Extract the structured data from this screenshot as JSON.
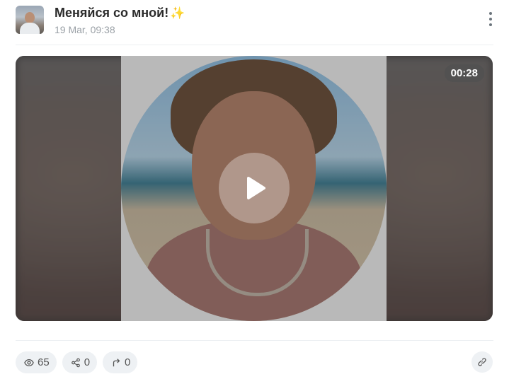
{
  "post": {
    "title": "Меняйся со мной!",
    "title_emoji": "✨",
    "date": "19 Mar, 09:38",
    "menu_icon": "more-vertical-icon"
  },
  "video": {
    "duration": "00:28",
    "play_icon": "play-icon"
  },
  "stats": {
    "views": "65",
    "shares": "0",
    "reposts": "0",
    "views_icon": "eye-icon",
    "shares_icon": "share-icon",
    "reposts_icon": "repost-arrow-icon",
    "link_icon": "link-icon"
  },
  "colors": {
    "pill_bg": "#eef1f4",
    "date_gray": "#9aa0a6",
    "sparkle_yellow": "#f2c200"
  }
}
